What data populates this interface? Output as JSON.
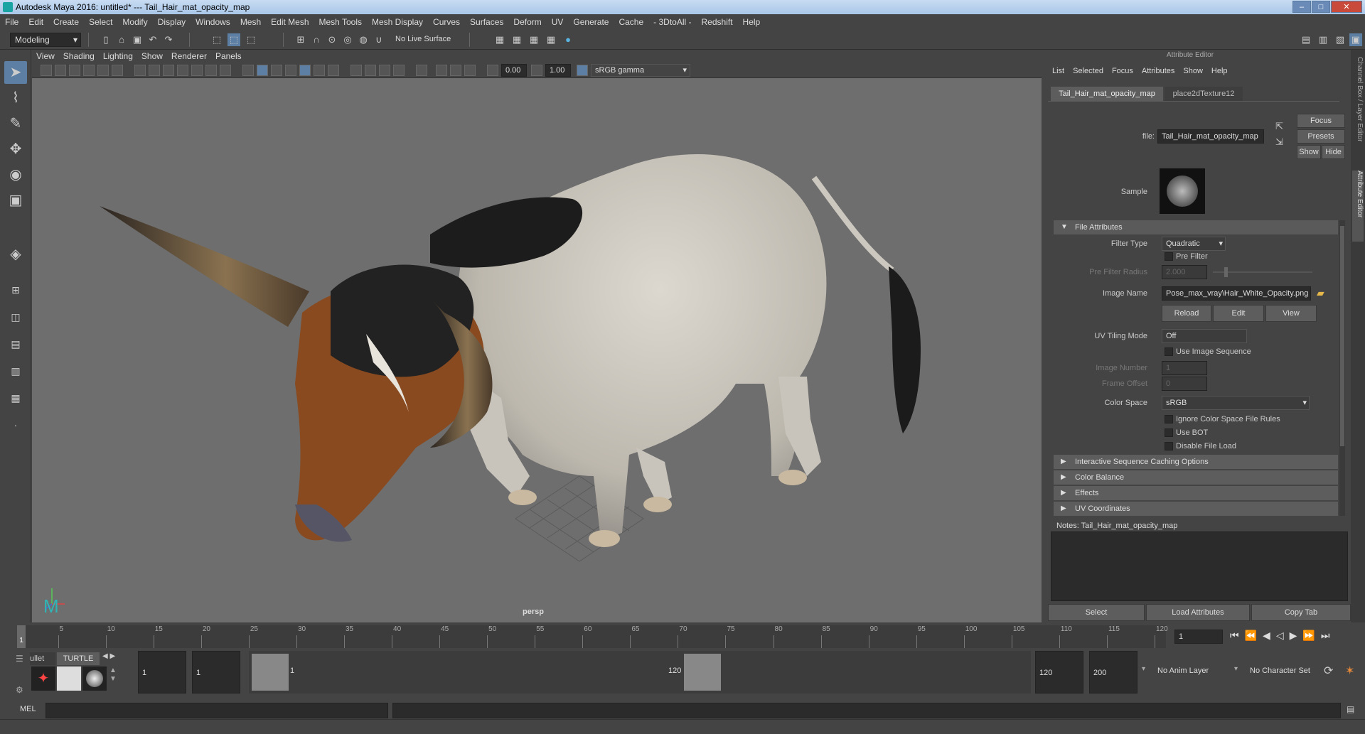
{
  "window": {
    "title": "Autodesk Maya 2016: untitled*   ---   Tail_Hair_mat_opacity_map"
  },
  "menubar": [
    "File",
    "Edit",
    "Create",
    "Select",
    "Modify",
    "Display",
    "Windows",
    "Mesh",
    "Edit Mesh",
    "Mesh Tools",
    "Mesh Display",
    "Curves",
    "Surfaces",
    "Deform",
    "UV",
    "Generate",
    "Cache",
    "- 3DtoAll -",
    "Redshift",
    "Help"
  ],
  "toolbar": {
    "mode": "Modeling",
    "live_surface": "No Live Surface"
  },
  "viewport": {
    "menu": [
      "View",
      "Shading",
      "Lighting",
      "Show",
      "Renderer",
      "Panels"
    ],
    "exposure": "0.00",
    "gamma": "1.00",
    "color_space": "sRGB gamma",
    "camera": "persp"
  },
  "attribute_editor": {
    "title": "Attribute Editor",
    "menu": [
      "List",
      "Selected",
      "Focus",
      "Attributes",
      "Show",
      "Help"
    ],
    "tabs": [
      "Tail_Hair_mat_opacity_map",
      "place2dTexture12"
    ],
    "file_label": "file:",
    "file_value": "Tail_Hair_mat_opacity_map",
    "focus": "Focus",
    "presets": "Presets",
    "show": "Show",
    "hide": "Hide",
    "sample_label": "Sample",
    "section_file": "File Attributes",
    "filter_type_label": "Filter Type",
    "filter_type": "Quadratic",
    "pre_filter": "Pre Filter",
    "pre_filter_radius_label": "Pre Filter Radius",
    "pre_filter_radius": "2.000",
    "image_name_label": "Image Name",
    "image_name": "Pose_max_vray\\Hair_White_Opacity.png",
    "reload": "Reload",
    "edit": "Edit",
    "view": "View",
    "uv_tiling_label": "UV Tiling Mode",
    "uv_tiling": "Off",
    "use_image_sequence": "Use Image Sequence",
    "image_number_label": "Image Number",
    "image_number": "1",
    "frame_offset_label": "Frame Offset",
    "frame_offset": "0",
    "color_space_label": "Color Space",
    "color_space": "sRGB",
    "ignore_cs": "Ignore Color Space File Rules",
    "use_bot": "Use BOT",
    "disable_file_load": "Disable File Load",
    "sections": [
      "Interactive Sequence Caching Options",
      "Color Balance",
      "Effects",
      "UV Coordinates"
    ],
    "notes": "Notes:  Tail_Hair_mat_opacity_map",
    "select": "Select",
    "load_attributes": "Load Attributes",
    "copy_tab": "Copy Tab",
    "side_tabs": [
      "Channel Box / Layer Editor",
      "Attribute Editor"
    ]
  },
  "timeline": {
    "ticks": [
      "1",
      "5",
      "10",
      "15",
      "20",
      "25",
      "30",
      "35",
      "40",
      "45",
      "50",
      "55",
      "60",
      "65",
      "70",
      "75",
      "80",
      "85",
      "90",
      "95",
      "100",
      "105",
      "110",
      "115",
      "120"
    ],
    "current_frame": "1"
  },
  "range": {
    "shelf_tabs": [
      "ullet",
      "TURTLE"
    ],
    "start": "1",
    "playback_start": "1",
    "range_start": "1",
    "range_end": "120",
    "playback_end": "120",
    "end": "200",
    "anim_layer": "No Anim Layer",
    "character_set": "No Character Set"
  },
  "cmd": {
    "label": "MEL"
  }
}
